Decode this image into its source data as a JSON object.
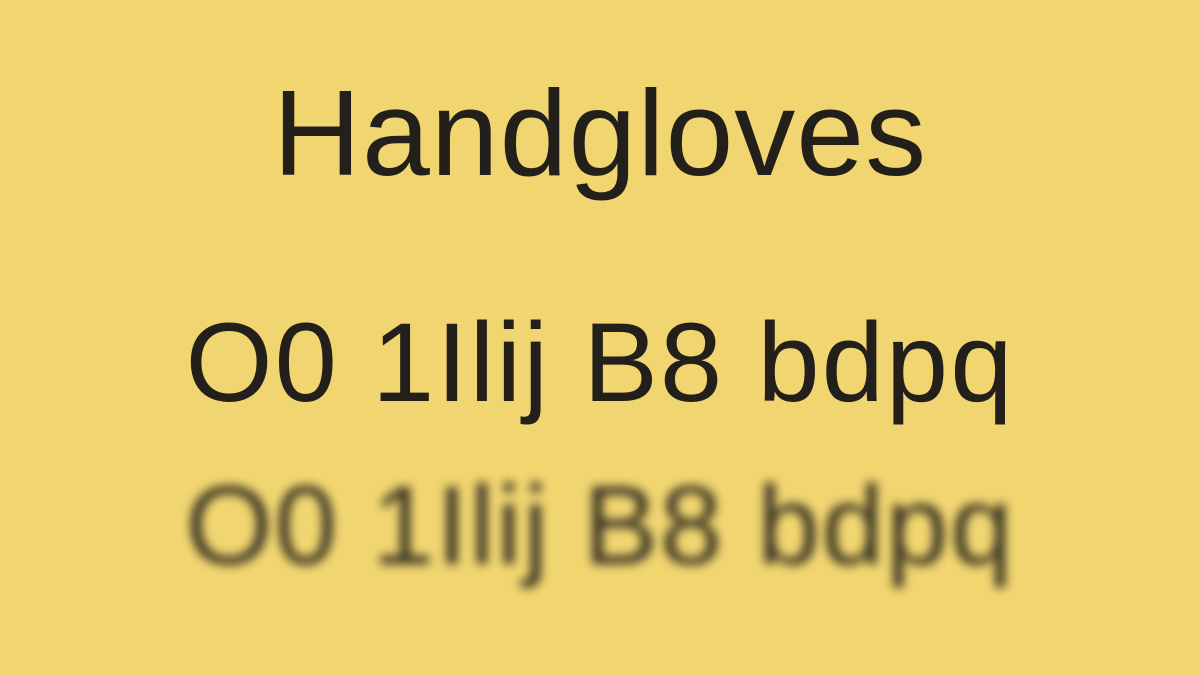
{
  "heading": "Handgloves",
  "sample_text": "O0 1Ilij B8 bdpq",
  "sample_text_blurred": "O0 1Ilij B8 bdpq",
  "colors": {
    "background": "#f0d570",
    "text": "#231f1a"
  }
}
